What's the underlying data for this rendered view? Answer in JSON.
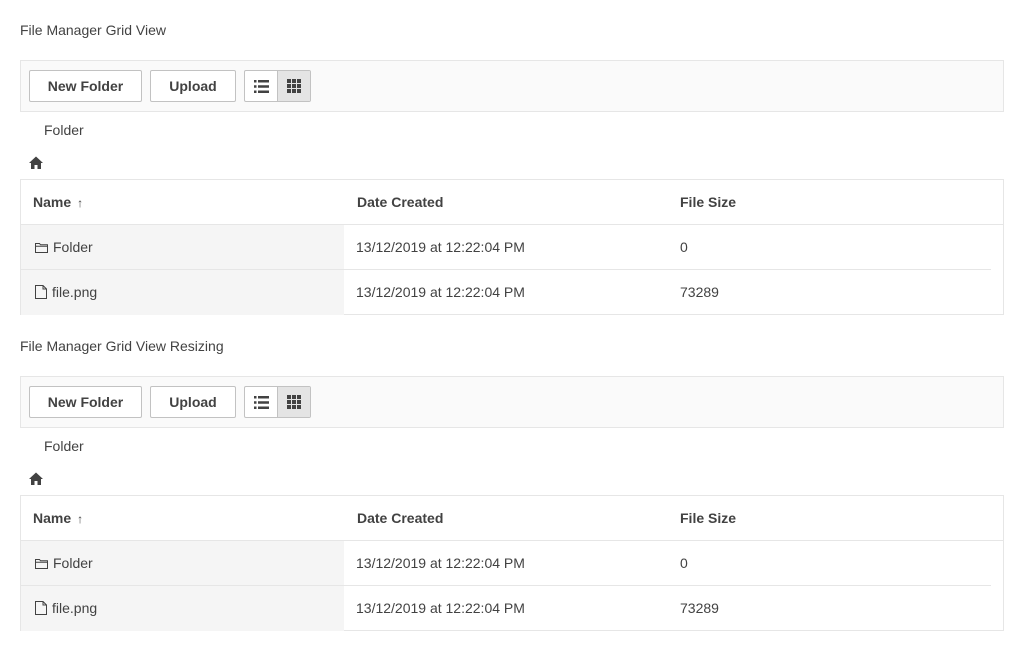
{
  "sections": [
    {
      "title": "File Manager Grid View",
      "toolbar": {
        "new_folder_label": "New Folder",
        "upload_label": "Upload",
        "active_view": "grid"
      },
      "breadcrumb": {
        "current": "Folder",
        "home_icon": "home-icon"
      },
      "columns": {
        "name": "Name",
        "date": "Date Created",
        "size": "File Size",
        "sort_icon": "arrow-up-icon"
      },
      "rows": [
        {
          "icon": "folder-icon",
          "name": "Folder",
          "date": "13/12/2019 at 12:22:04 PM",
          "size": "0"
        },
        {
          "icon": "file-icon",
          "name": "file.png",
          "date": "13/12/2019 at 12:22:04 PM",
          "size": "73289"
        }
      ]
    },
    {
      "title": "File Manager Grid View Resizing",
      "toolbar": {
        "new_folder_label": "New Folder",
        "upload_label": "Upload",
        "active_view": "grid"
      },
      "breadcrumb": {
        "current": "Folder",
        "home_icon": "home-icon"
      },
      "columns": {
        "name": "Name",
        "date": "Date Created",
        "size": "File Size",
        "sort_icon": "arrow-up-icon"
      },
      "rows": [
        {
          "icon": "folder-icon",
          "name": "Folder",
          "date": "13/12/2019 at 12:22:04 PM",
          "size": "0"
        },
        {
          "icon": "file-icon",
          "name": "file.png",
          "date": "13/12/2019 at 12:22:04 PM",
          "size": "73289"
        }
      ]
    }
  ]
}
